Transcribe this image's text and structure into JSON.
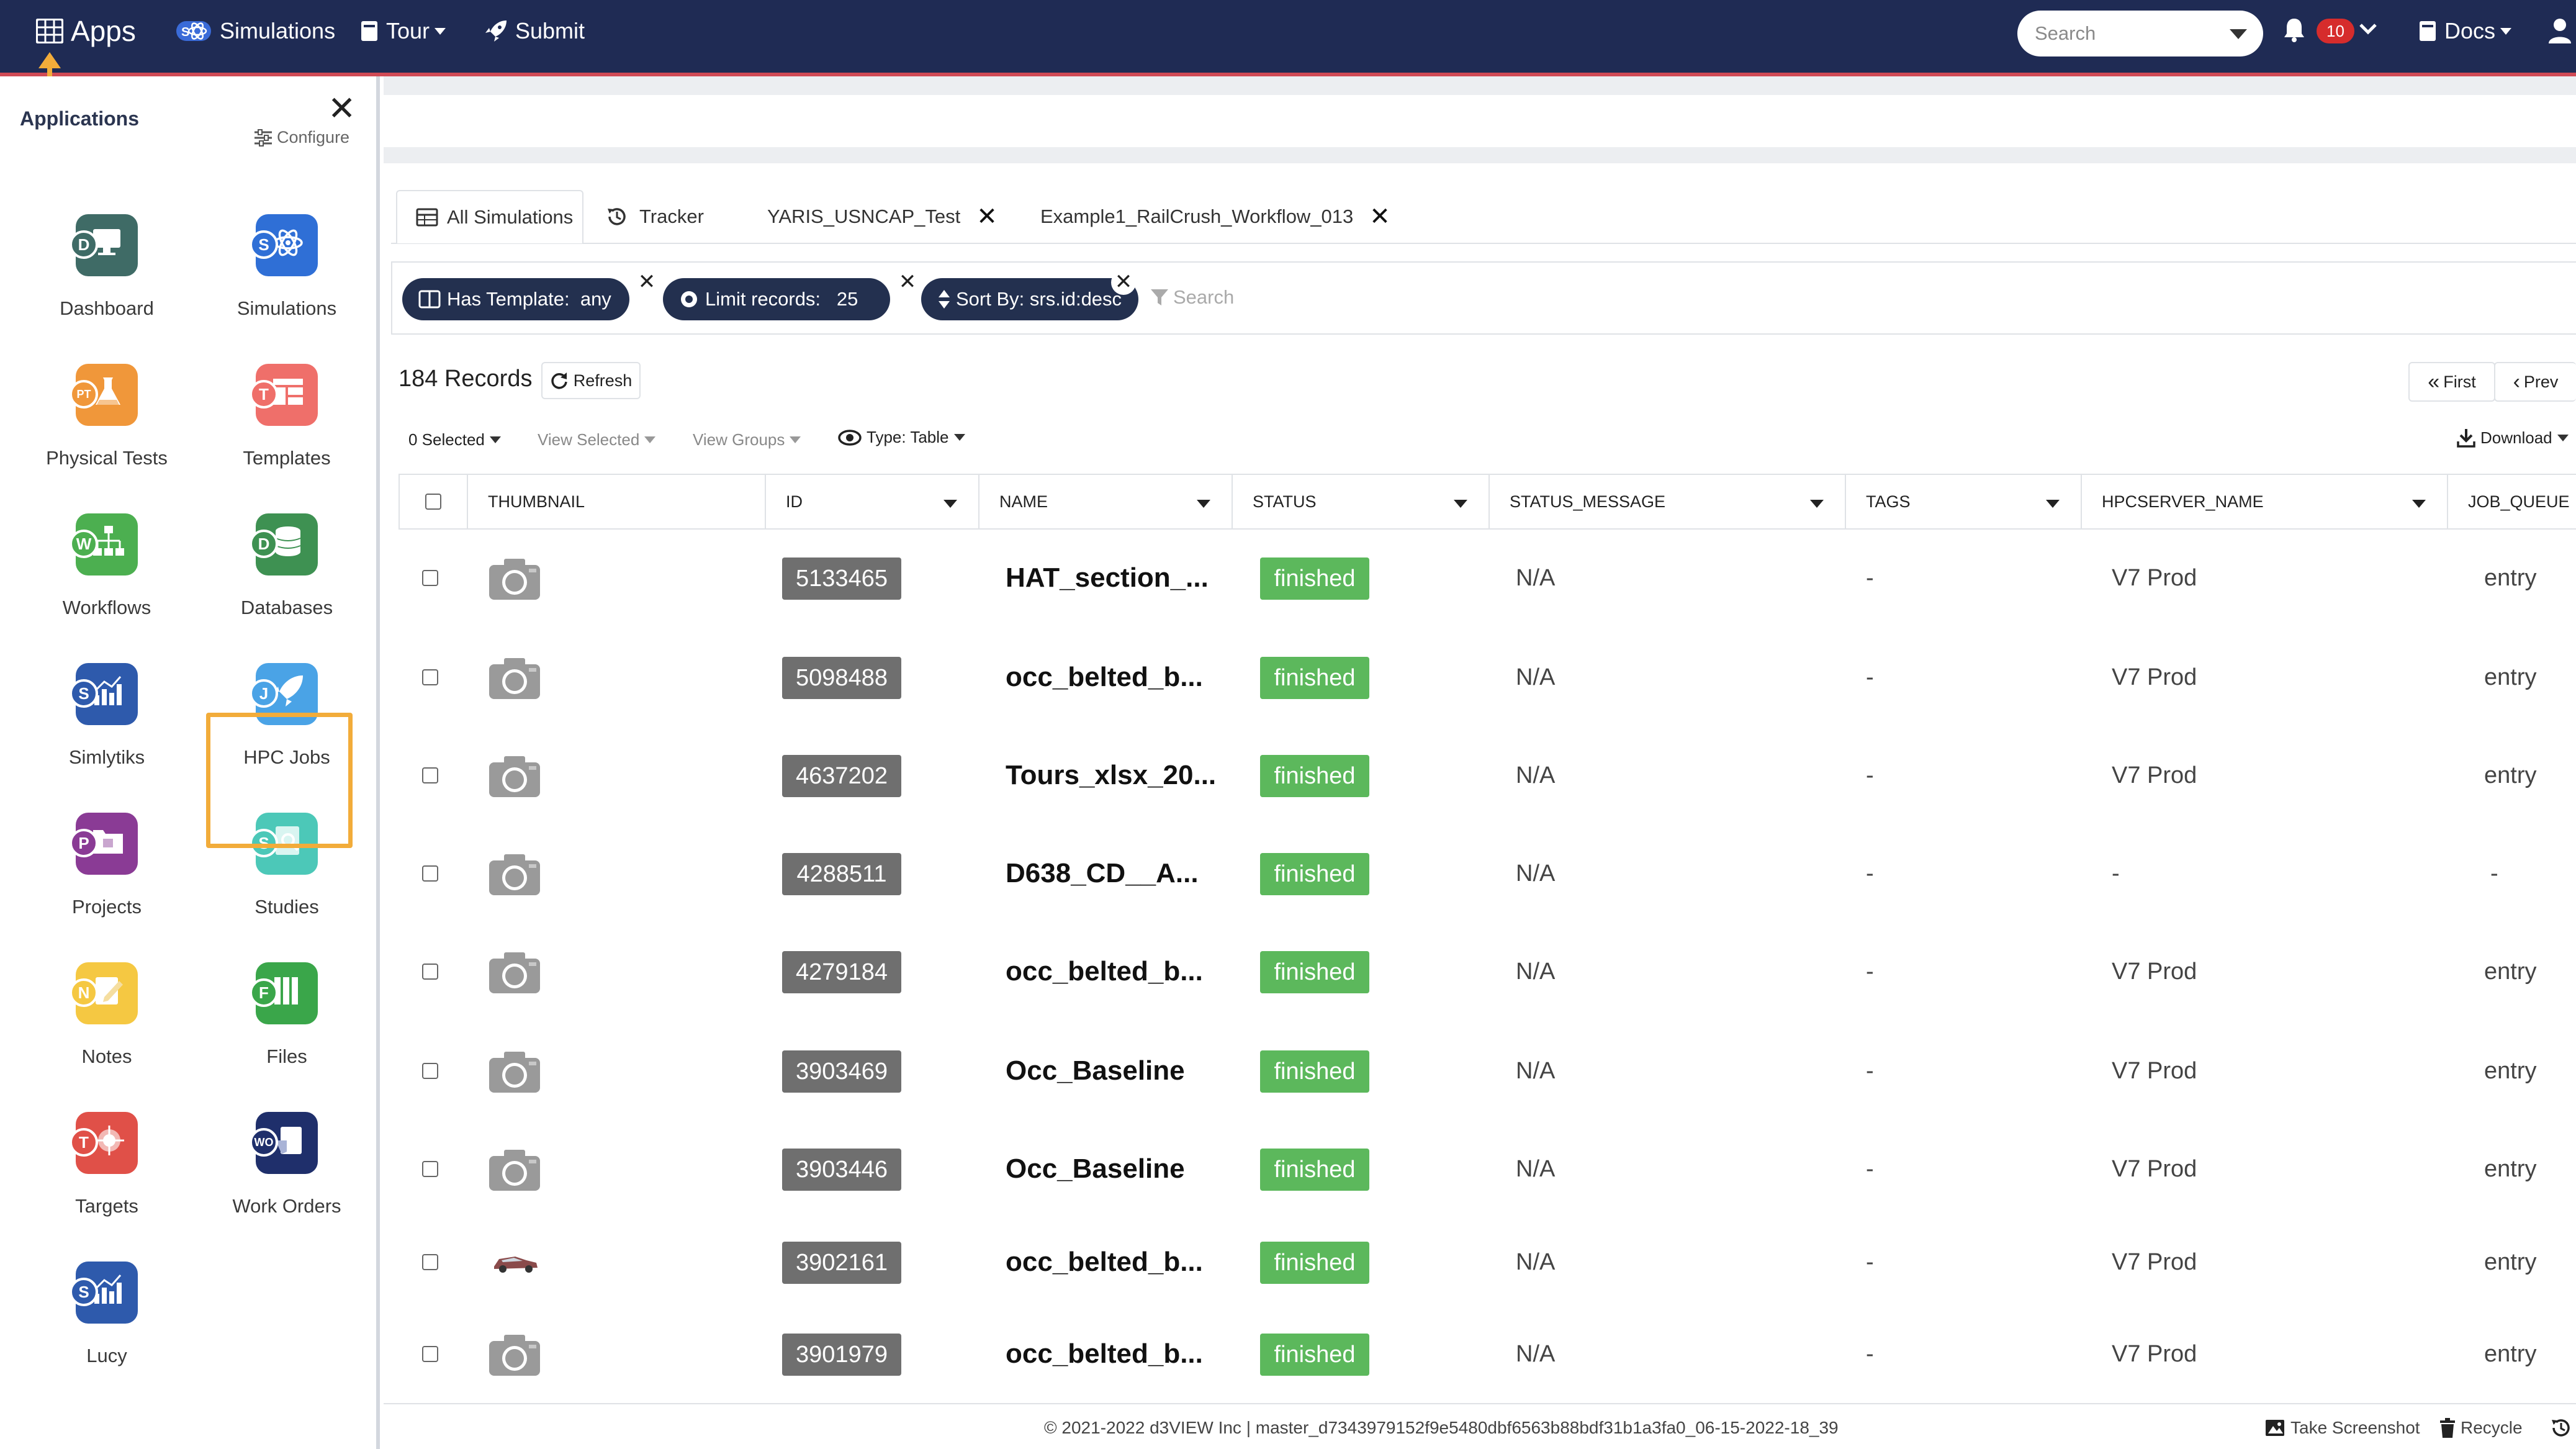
{
  "nav": {
    "apps_label": "Apps",
    "simulations_label": "Simulations",
    "tour_label": "Tour",
    "submit_label": "Submit",
    "search_placeholder": "Search",
    "notification_count": "10",
    "docs_label": "Docs"
  },
  "sidebar": {
    "title": "Applications",
    "configure_label": "Configure",
    "apps": [
      {
        "label": "Dashboard",
        "letter": "D",
        "color": "#3f6b66",
        "icon": "monitor-icon"
      },
      {
        "label": "Simulations",
        "letter": "S",
        "color": "#2f6fd6",
        "icon": "atom-icon"
      },
      {
        "label": "Physical Tests",
        "letter": "PT",
        "color": "#f0973a",
        "icon": "flask-icon"
      },
      {
        "label": "Templates",
        "letter": "T",
        "color": "#ef6f6a",
        "icon": "template-icon"
      },
      {
        "label": "Workflows",
        "letter": "W",
        "color": "#4caf50",
        "icon": "workflow-icon"
      },
      {
        "label": "Databases",
        "letter": "D",
        "color": "#3e9152",
        "icon": "database-icon"
      },
      {
        "label": "Simlytiks",
        "letter": "S",
        "color": "#2e5aac",
        "icon": "analytics-icon"
      },
      {
        "label": "HPC Jobs",
        "letter": "J",
        "color": "#4aa3e6",
        "icon": "rocket-icon"
      },
      {
        "label": "Projects",
        "letter": "P",
        "color": "#8a3b95",
        "icon": "folder-icon"
      },
      {
        "label": "Studies",
        "letter": "S",
        "color": "#4cc8b8",
        "icon": "study-icon"
      },
      {
        "label": "Notes",
        "letter": "N",
        "color": "#f5c842",
        "icon": "note-icon"
      },
      {
        "label": "Files",
        "letter": "F",
        "color": "#3aa64a",
        "icon": "files-icon"
      },
      {
        "label": "Targets",
        "letter": "T",
        "color": "#e05048",
        "icon": "target-icon"
      },
      {
        "label": "Work Orders",
        "letter": "WO",
        "color": "#1f2f6b",
        "icon": "work-order-icon"
      },
      {
        "label": "Lucy",
        "letter": "S",
        "color": "#2e5aac",
        "icon": "analytics-icon"
      }
    ]
  },
  "tabs": [
    {
      "label": "All Simulations"
    },
    {
      "label": "Tracker"
    },
    {
      "label": "YARIS_USNCAP_Test"
    },
    {
      "label": "Example1_RailCrush_Workflow_013"
    }
  ],
  "filters": {
    "template_label": "Has Template:",
    "template_value": "any",
    "limit_label": "Limit records:",
    "limit_value": "25",
    "sort_label": "Sort By:",
    "sort_value": "srs.id:desc",
    "search_placeholder": "Search"
  },
  "toolbar": {
    "record_count": "184 Records",
    "refresh_label": "Refresh",
    "selected_label": "0 Selected",
    "view_selected_label": "View Selected",
    "view_groups_label": "View Groups",
    "type_label": "Type: Table",
    "first_label": "First",
    "prev_label": "Prev",
    "download_label": "Download"
  },
  "table": {
    "headers": [
      "THUMBNAIL",
      "ID",
      "NAME",
      "STATUS",
      "STATUS_MESSAGE",
      "TAGS",
      "HPCSERVER_NAME",
      "JOB_QUEUE"
    ],
    "rows": [
      {
        "id": "5133465",
        "name": "HAT_section_...",
        "status": "finished",
        "status_message": "N/A",
        "tags": "-",
        "server": "V7 Prod",
        "queue": "entry",
        "thumb": "camera"
      },
      {
        "id": "5098488",
        "name": "occ_belted_b...",
        "status": "finished",
        "status_message": "N/A",
        "tags": "-",
        "server": "V7 Prod",
        "queue": "entry",
        "thumb": "camera"
      },
      {
        "id": "4637202",
        "name": "Tours_xlsx_20...",
        "status": "finished",
        "status_message": "N/A",
        "tags": "-",
        "server": "V7 Prod",
        "queue": "entry",
        "thumb": "camera"
      },
      {
        "id": "4288511",
        "name": "D638_CD__A...",
        "status": "finished",
        "status_message": "N/A",
        "tags": "-",
        "server": "-",
        "queue": "-",
        "thumb": "camera"
      },
      {
        "id": "4279184",
        "name": "occ_belted_b...",
        "status": "finished",
        "status_message": "N/A",
        "tags": "-",
        "server": "V7 Prod",
        "queue": "entry",
        "thumb": "camera"
      },
      {
        "id": "3903469",
        "name": "Occ_Baseline",
        "status": "finished",
        "status_message": "N/A",
        "tags": "-",
        "server": "V7 Prod",
        "queue": "entry",
        "thumb": "camera"
      },
      {
        "id": "3903446",
        "name": "Occ_Baseline",
        "status": "finished",
        "status_message": "N/A",
        "tags": "-",
        "server": "V7 Prod",
        "queue": "entry",
        "thumb": "camera"
      },
      {
        "id": "3902161",
        "name": "occ_belted_b...",
        "status": "finished",
        "status_message": "N/A",
        "tags": "-",
        "server": "V7 Prod",
        "queue": "entry",
        "thumb": "car"
      },
      {
        "id": "3901979",
        "name": "occ_belted_b...",
        "status": "finished",
        "status_message": "N/A",
        "tags": "-",
        "server": "V7 Prod",
        "queue": "entry",
        "thumb": "camera"
      }
    ]
  },
  "footer": {
    "copyright": "© 2021-2022 d3VIEW Inc | master_d7343979152f9e5480dbf6563b88bdf31b1a3fa0_06-15-2022-18_39",
    "screenshot_label": "Take Screenshot",
    "recycle_label": "Recycle"
  }
}
